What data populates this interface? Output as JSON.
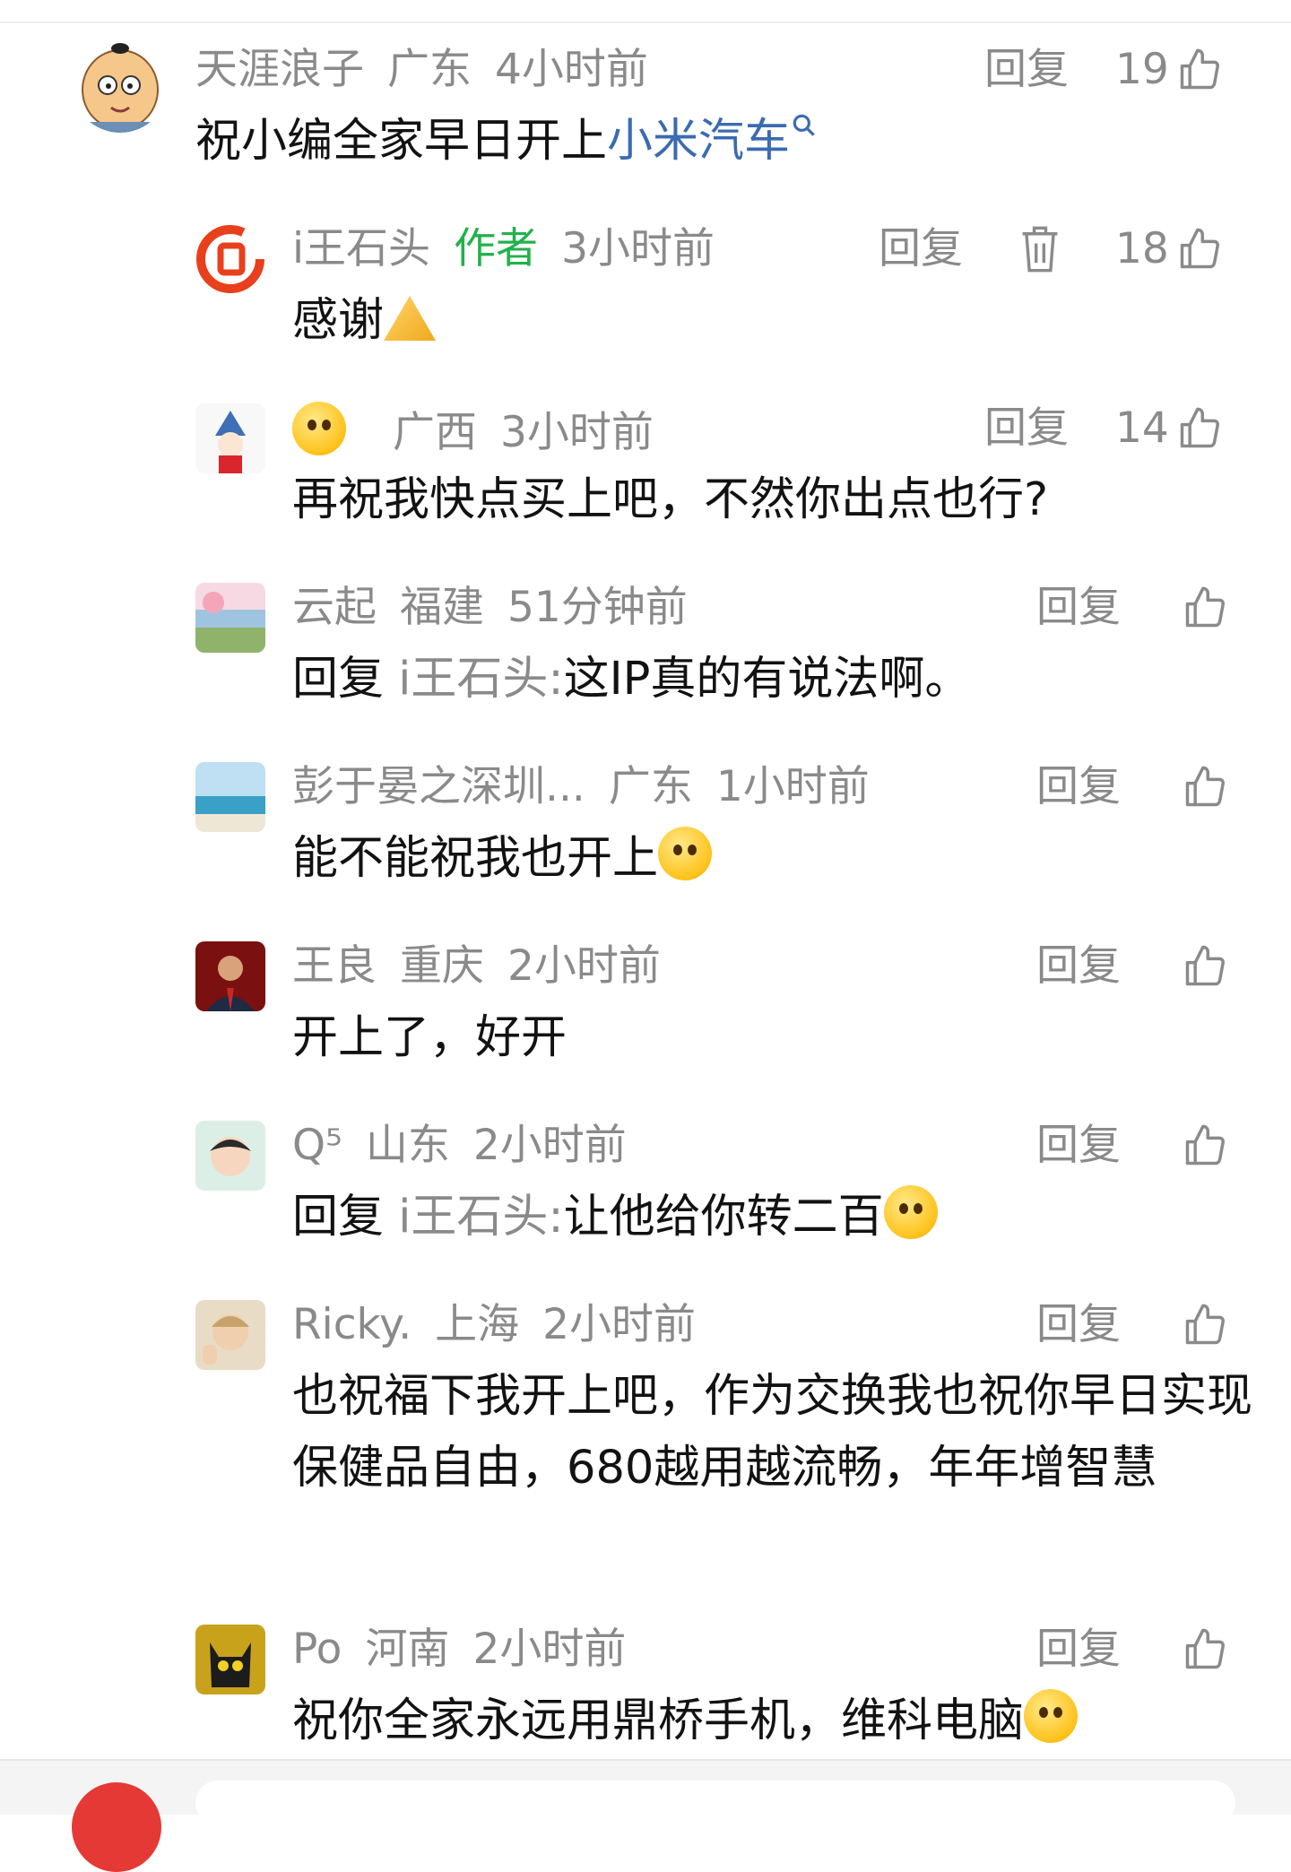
{
  "ui": {
    "reply_label": "回复"
  },
  "comments": [
    {
      "user": "天涯浪子",
      "location": "广东",
      "time": "4小时前",
      "text_prefix": "祝小编全家早日开上",
      "link_text": "小米汽车",
      "likes": "19"
    },
    {
      "user": "i王石头",
      "badge": "作者",
      "time": "3小时前",
      "text": "感谢",
      "likes": "18"
    },
    {
      "user": "",
      "location": "广西",
      "time": "3小时前",
      "text": "再祝我快点买上吧，不然你出点也行?",
      "likes": "14"
    },
    {
      "user": "云起",
      "location": "福建",
      "time": "51分钟前",
      "reply_label": "回复",
      "mention": "i王石头:",
      "text": "这IP真的有说法啊。",
      "likes": ""
    },
    {
      "user": "彭于晏之深圳...",
      "location": "广东",
      "time": "1小时前",
      "text": "能不能祝我也开上",
      "likes": ""
    },
    {
      "user": "王良",
      "location": "重庆",
      "time": "2小时前",
      "text": "开上了，好开",
      "likes": ""
    },
    {
      "user": "Q⁵",
      "location": "山东",
      "time": "2小时前",
      "reply_label": "回复",
      "mention": "i王石头:",
      "text": "让他给你转二百",
      "likes": ""
    },
    {
      "user": "Ricky.",
      "location": "上海",
      "time": "2小时前",
      "text": "也祝福下我开上吧，作为交换我也祝你早日实现保健品自由，680越用越流畅，年年增智慧",
      "likes": ""
    },
    {
      "user": "Po",
      "location": "河南",
      "time": "2小时前",
      "text": "祝你全家永远用鼎桥手机，维科电脑",
      "likes": ""
    }
  ],
  "icons": {
    "like": "thumbs-up-icon",
    "delete": "trash-icon",
    "search": "search-icon"
  },
  "colors": {
    "author_badge": "#22b14c",
    "link": "#3b6bb0",
    "meta": "#8a8a8a"
  }
}
